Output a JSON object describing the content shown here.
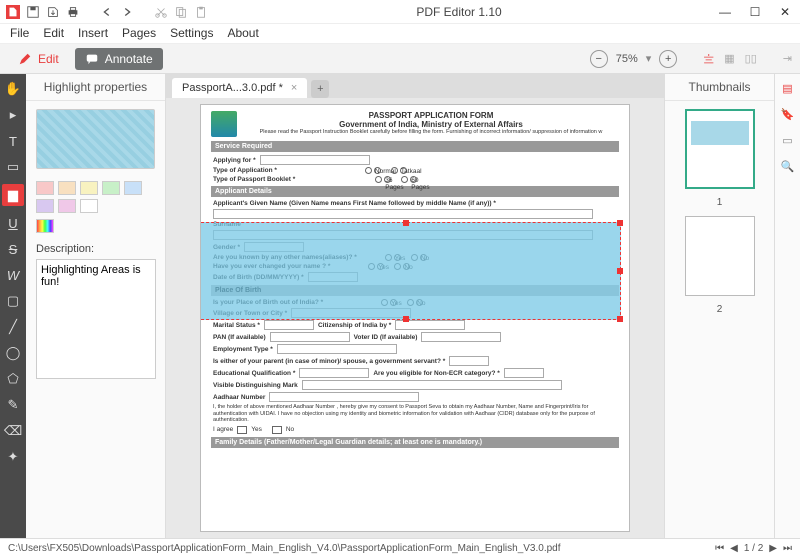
{
  "app": {
    "title": "PDF Editor 1.10"
  },
  "menu": [
    "File",
    "Edit",
    "Insert",
    "Pages",
    "Settings",
    "About"
  ],
  "ribbon": {
    "edit": "Edit",
    "annotate": "Annotate",
    "zoom": "75%"
  },
  "panel": {
    "title": "Highlight properties",
    "descLabel": "Description:",
    "descValue": "Highlighting Areas is fun!",
    "swatches": [
      "#f8c8c8",
      "#f8e0c0",
      "#f8f2c0",
      "#c8f0c8",
      "#c8e0f8",
      "#d8c8f0",
      "#f0c8e8",
      "#ffffff"
    ],
    "rainbow": "linear-gradient(90deg,#f44,#fa4,#ff4,#4f4,#4ff,#44f,#f4f)"
  },
  "tab": {
    "label": "PassportA...3.0.pdf *"
  },
  "thumbs": {
    "title": "Thumbnails",
    "pages": [
      "1",
      "2"
    ]
  },
  "doc": {
    "title1": "PASSPORT APPLICATION FORM",
    "title2": "Government of India, Ministry of External Affairs",
    "instr": "Please read the Passport Instruction Booklet carefully before filling the form. Furnishing of incorrect information/ suppression of information w",
    "sec1": "Service Required",
    "applyingFor": "Applying for *",
    "typeApp": "Type of Application *",
    "normal": "Normal",
    "tatkaal": "Tatkaal",
    "typeBook": "Type of Passport Booklet *",
    "p36": "36 Pages",
    "p60": "60 Pages",
    "sec2": "Applicant Details",
    "given": "Applicant's Given Name (Given Name means First Name followed by middle Name (if any)) *",
    "surname": "Surname",
    "gender": "Gender *",
    "aliases": "Are you known by any other names(aliases)? *",
    "yes": "Yes",
    "no": "No",
    "changed": "Have you ever changed your name ? *",
    "dob": "Date of Birth (DD/MM/YYYY) *",
    "sec3": "Place Of Birth",
    "outIndia": "Is your Place of Birth out of India? *",
    "village": "Village or Town or City *",
    "marital": "Marital Status *",
    "citizen": "Citizenship of India by *",
    "pan": "PAN (If available)",
    "voter": "Voter ID (If available)",
    "emp": "Employment Type *",
    "parent": "Is either of your parent (in case of minor)/ spouse, a government servant? *",
    "edu": "Educational Qualification *",
    "ecr": "Are you eligible for Non-ECR category? *",
    "marks": "Visible Distinguishing Mark",
    "aadhaar": "Aadhaar Number",
    "consent": "I, the holder of above mentioned Aadhaar Number , hereby give my consent to Passport Seva to obtain my Aadhaar Number, Name and Fingerprint/Iris for authentication with UIDAI. I have no objection using my identity and biometric information for validation with Aadhaar (CIDR) database only for the purpose of authentication.",
    "agree": "I agree",
    "sec4": "Family Details (Father/Mother/Legal Guardian details; at least one is mandatory.)"
  },
  "status": {
    "path": "C:\\Users\\FX505\\Downloads\\PassportApplicationForm_Main_English_V4.0\\PassportApplicationForm_Main_English_V3.0.pdf",
    "page": "1 / 2"
  }
}
